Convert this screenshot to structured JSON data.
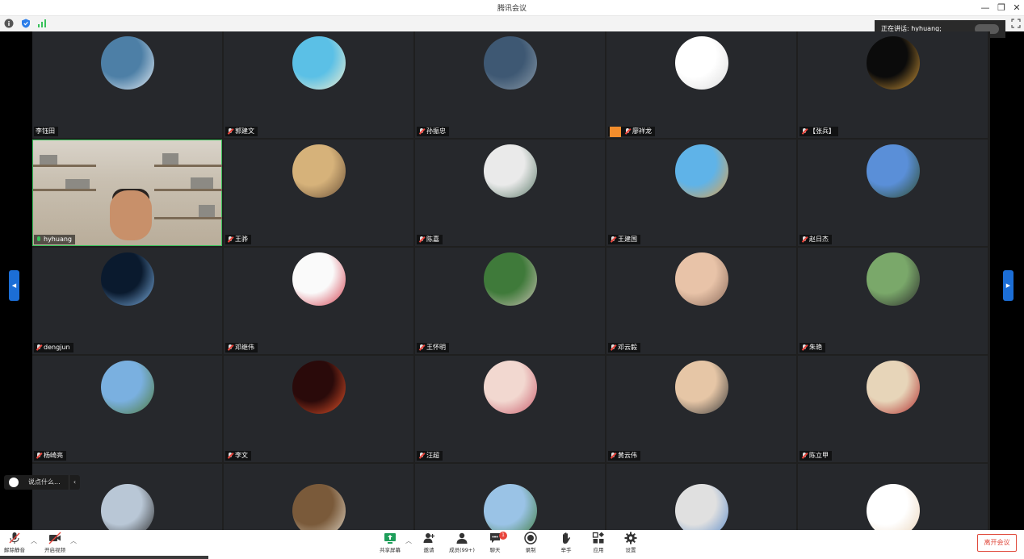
{
  "window": {
    "title": "腾讯会议"
  },
  "speaking": {
    "label": "正在讲话: hyhuang;"
  },
  "chat": {
    "placeholder": "说点什么..."
  },
  "participants": [
    {
      "name": "李钰田",
      "muted": false,
      "color": "#4d7fa6",
      "color2": "#e6eef5"
    },
    {
      "name": "郭建文",
      "muted": true,
      "color": "#5bc0e6",
      "color2": "#f4efd0"
    },
    {
      "name": "孙振忠",
      "muted": true,
      "color": "#3e5873",
      "color2": "#8a9aa8"
    },
    {
      "name": "廖祥龙",
      "muted": true,
      "color": "#ffffff",
      "color2": "#dcdcdc",
      "hand": true
    },
    {
      "name": "【张兵】",
      "muted": true,
      "color": "#0b0b0b",
      "color2": "#d49a3a"
    },
    {
      "name": "hyhuang",
      "muted": false,
      "video": true
    },
    {
      "name": "王骅",
      "muted": true,
      "color": "#d6b27a",
      "color2": "#6a5037"
    },
    {
      "name": "陈嘉",
      "muted": true,
      "color": "#eaeaea",
      "color2": "#5c7a6a"
    },
    {
      "name": "王建国",
      "muted": true,
      "color": "#5fb3e8",
      "color2": "#e0a34c"
    },
    {
      "name": "赵日杰",
      "muted": true,
      "color": "#5a8fd8",
      "color2": "#2e4a2a"
    },
    {
      "name": "dengjun",
      "muted": true,
      "color": "#0a1a2e",
      "color2": "#7fb3e6"
    },
    {
      "name": "邓继伟",
      "muted": true,
      "color": "#fafafa",
      "color2": "#d23a4a"
    },
    {
      "name": "王怀明",
      "muted": true,
      "color": "#3f7a3a",
      "color2": "#c9c2b3"
    },
    {
      "name": "邓云毅",
      "muted": true,
      "color": "#e8c3a8",
      "color2": "#8a6a5a"
    },
    {
      "name": "朱艳",
      "muted": true,
      "color": "#7aa86a",
      "color2": "#2a2a2a"
    },
    {
      "name": "杨崎亮",
      "muted": true,
      "color": "#7ab0e0",
      "color2": "#4e7a3a"
    },
    {
      "name": "李文",
      "muted": true,
      "color": "#2a0a0a",
      "color2": "#e8542a"
    },
    {
      "name": "汪超",
      "muted": true,
      "color": "#f2d8d0",
      "color2": "#c85a6a"
    },
    {
      "name": "黄云伟",
      "muted": true,
      "color": "#e6c6a6",
      "color2": "#3a3a3a"
    },
    {
      "name": "陈立甲",
      "muted": true,
      "color": "#e7d5b9",
      "color2": "#b02a2a"
    },
    {
      "name": "",
      "muted": false,
      "color": "#b9c7d6",
      "color2": "#2a2a2a"
    },
    {
      "name": "",
      "muted": false,
      "color": "#7a5a3a",
      "color2": "#e0d6c6"
    },
    {
      "name": "",
      "muted": false,
      "color": "#9ac3e6",
      "color2": "#3e7a3a"
    },
    {
      "name": "",
      "muted": false,
      "color": "#e0e0e0",
      "color2": "#5a8ac8"
    },
    {
      "name": "",
      "muted": false,
      "color": "#ffffff",
      "color2": "#e9d2b7"
    }
  ],
  "toolbar": {
    "unmute": "解除静音",
    "start_video": "开启视频",
    "share": "共享屏幕",
    "invite": "邀请",
    "members": "成员(99+)",
    "chat": "聊天",
    "chat_badge": "1",
    "record": "录制",
    "raise_hand": "举手",
    "apps": "应用",
    "settings": "设置",
    "leave": "离开会议"
  }
}
